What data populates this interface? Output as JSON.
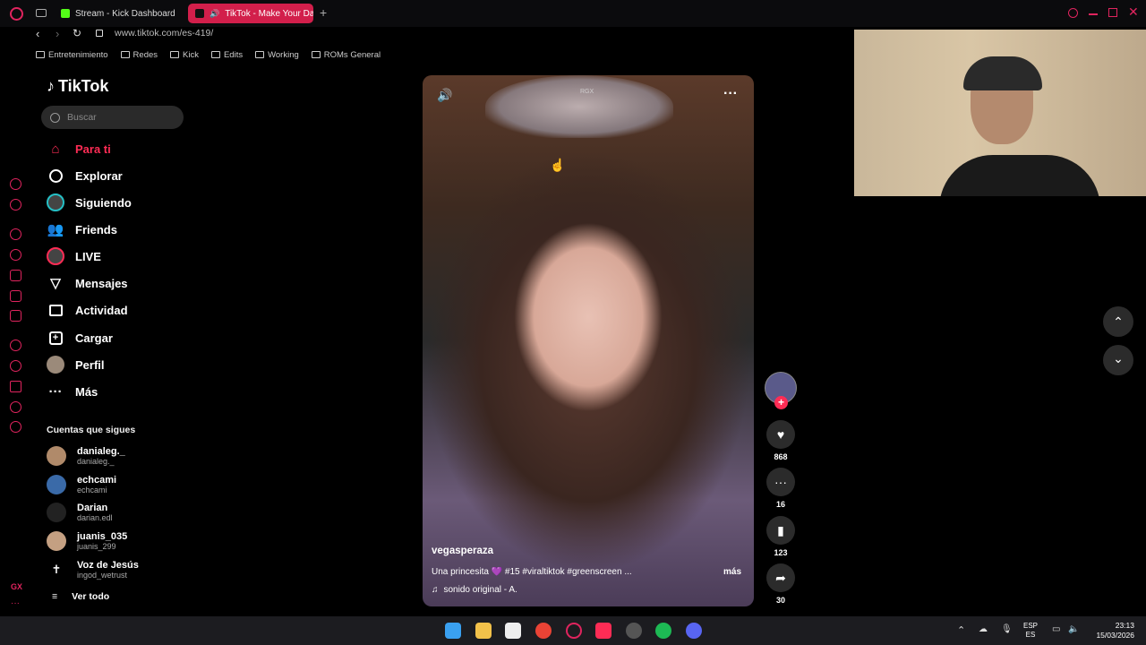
{
  "browser": {
    "tabs": [
      {
        "label": "Stream - Kick Dashboard"
      },
      {
        "label": "TikTok - Make Your Da"
      }
    ],
    "url": "www.tiktok.com/es-419/",
    "bookmarks": [
      "Entretenimiento",
      "Redes",
      "Kick",
      "Edits",
      "Working",
      "ROMs General"
    ]
  },
  "tiktok": {
    "logo": "TikTok",
    "search_placeholder": "Buscar",
    "nav": [
      {
        "label": "Para ti",
        "icon": "home-icon"
      },
      {
        "label": "Explorar",
        "icon": "compass-icon"
      },
      {
        "label": "Siguiendo",
        "icon": "following-icon"
      },
      {
        "label": "Friends",
        "icon": "friends-icon"
      },
      {
        "label": "LIVE",
        "icon": "live-icon"
      },
      {
        "label": "Mensajes",
        "icon": "messages-icon"
      },
      {
        "label": "Actividad",
        "icon": "activity-icon"
      },
      {
        "label": "Cargar",
        "icon": "upload-icon"
      },
      {
        "label": "Perfil",
        "icon": "profile-icon"
      },
      {
        "label": "Más",
        "icon": "more-icon"
      }
    ],
    "following_title": "Cuentas que sigues",
    "following": [
      {
        "name": "danialeg._",
        "handle": "danialeg._"
      },
      {
        "name": "echcami",
        "handle": "echcami"
      },
      {
        "name": "Darian",
        "handle": "darian.edl"
      },
      {
        "name": "juanis_035",
        "handle": "juanis_299"
      },
      {
        "name": "Voz de Jesús",
        "handle": "ingod_wetrust"
      }
    ],
    "see_all": "Ver todo",
    "video": {
      "username": "vegasperaza",
      "caption": "Una princesita 💜 #15 #viraltiktok #greenscreen ...",
      "more": "más",
      "sound": "sonido original - A.",
      "watermark": "RGX"
    },
    "actions": {
      "likes": "868",
      "comments": "16",
      "saves": "123",
      "shares": "30"
    }
  },
  "taskbar": {
    "lang_top": "ESP",
    "lang_bottom": "ES",
    "time": "23:13",
    "date": "15/03/2026"
  },
  "colors": {
    "accent": "#fe2c55",
    "opera_red": "#e0245e"
  }
}
